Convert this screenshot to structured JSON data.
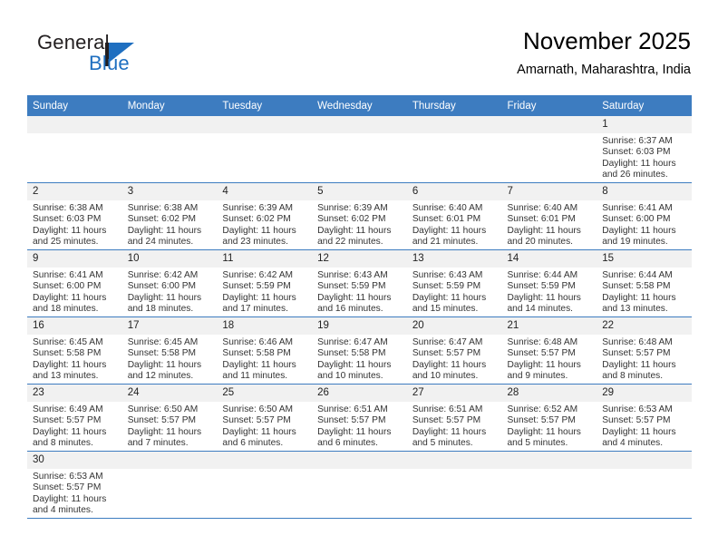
{
  "brand": {
    "name_part1": "General",
    "name_part2": "Blue",
    "logo_icon": "triangle-flag-logo"
  },
  "header": {
    "title": "November 2025",
    "subtitle": "Amarnath, Maharashtra, India"
  },
  "colors": {
    "header_blue": "#3d7cc0",
    "daynum_band": "#f1f1f1",
    "brand_blue": "#1f6fc0",
    "text": "#333333"
  },
  "weekdays": [
    "Sunday",
    "Monday",
    "Tuesday",
    "Wednesday",
    "Thursday",
    "Friday",
    "Saturday"
  ],
  "labels": {
    "sunrise_prefix": "Sunrise:",
    "sunset_prefix": "Sunset:",
    "daylight_prefix": "Daylight:"
  },
  "weeks": [
    [
      {
        "day": "",
        "empty": true
      },
      {
        "day": "",
        "empty": true
      },
      {
        "day": "",
        "empty": true
      },
      {
        "day": "",
        "empty": true
      },
      {
        "day": "",
        "empty": true
      },
      {
        "day": "",
        "empty": true
      },
      {
        "day": "1",
        "sunrise": "Sunrise: 6:37 AM",
        "sunset": "Sunset: 6:03 PM",
        "daylight": "Daylight: 11 hours and 26 minutes."
      }
    ],
    [
      {
        "day": "2",
        "sunrise": "Sunrise: 6:38 AM",
        "sunset": "Sunset: 6:03 PM",
        "daylight": "Daylight: 11 hours and 25 minutes."
      },
      {
        "day": "3",
        "sunrise": "Sunrise: 6:38 AM",
        "sunset": "Sunset: 6:02 PM",
        "daylight": "Daylight: 11 hours and 24 minutes."
      },
      {
        "day": "4",
        "sunrise": "Sunrise: 6:39 AM",
        "sunset": "Sunset: 6:02 PM",
        "daylight": "Daylight: 11 hours and 23 minutes."
      },
      {
        "day": "5",
        "sunrise": "Sunrise: 6:39 AM",
        "sunset": "Sunset: 6:02 PM",
        "daylight": "Daylight: 11 hours and 22 minutes."
      },
      {
        "day": "6",
        "sunrise": "Sunrise: 6:40 AM",
        "sunset": "Sunset: 6:01 PM",
        "daylight": "Daylight: 11 hours and 21 minutes."
      },
      {
        "day": "7",
        "sunrise": "Sunrise: 6:40 AM",
        "sunset": "Sunset: 6:01 PM",
        "daylight": "Daylight: 11 hours and 20 minutes."
      },
      {
        "day": "8",
        "sunrise": "Sunrise: 6:41 AM",
        "sunset": "Sunset: 6:00 PM",
        "daylight": "Daylight: 11 hours and 19 minutes."
      }
    ],
    [
      {
        "day": "9",
        "sunrise": "Sunrise: 6:41 AM",
        "sunset": "Sunset: 6:00 PM",
        "daylight": "Daylight: 11 hours and 18 minutes."
      },
      {
        "day": "10",
        "sunrise": "Sunrise: 6:42 AM",
        "sunset": "Sunset: 6:00 PM",
        "daylight": "Daylight: 11 hours and 18 minutes."
      },
      {
        "day": "11",
        "sunrise": "Sunrise: 6:42 AM",
        "sunset": "Sunset: 5:59 PM",
        "daylight": "Daylight: 11 hours and 17 minutes."
      },
      {
        "day": "12",
        "sunrise": "Sunrise: 6:43 AM",
        "sunset": "Sunset: 5:59 PM",
        "daylight": "Daylight: 11 hours and 16 minutes."
      },
      {
        "day": "13",
        "sunrise": "Sunrise: 6:43 AM",
        "sunset": "Sunset: 5:59 PM",
        "daylight": "Daylight: 11 hours and 15 minutes."
      },
      {
        "day": "14",
        "sunrise": "Sunrise: 6:44 AM",
        "sunset": "Sunset: 5:59 PM",
        "daylight": "Daylight: 11 hours and 14 minutes."
      },
      {
        "day": "15",
        "sunrise": "Sunrise: 6:44 AM",
        "sunset": "Sunset: 5:58 PM",
        "daylight": "Daylight: 11 hours and 13 minutes."
      }
    ],
    [
      {
        "day": "16",
        "sunrise": "Sunrise: 6:45 AM",
        "sunset": "Sunset: 5:58 PM",
        "daylight": "Daylight: 11 hours and 13 minutes."
      },
      {
        "day": "17",
        "sunrise": "Sunrise: 6:45 AM",
        "sunset": "Sunset: 5:58 PM",
        "daylight": "Daylight: 11 hours and 12 minutes."
      },
      {
        "day": "18",
        "sunrise": "Sunrise: 6:46 AM",
        "sunset": "Sunset: 5:58 PM",
        "daylight": "Daylight: 11 hours and 11 minutes."
      },
      {
        "day": "19",
        "sunrise": "Sunrise: 6:47 AM",
        "sunset": "Sunset: 5:58 PM",
        "daylight": "Daylight: 11 hours and 10 minutes."
      },
      {
        "day": "20",
        "sunrise": "Sunrise: 6:47 AM",
        "sunset": "Sunset: 5:57 PM",
        "daylight": "Daylight: 11 hours and 10 minutes."
      },
      {
        "day": "21",
        "sunrise": "Sunrise: 6:48 AM",
        "sunset": "Sunset: 5:57 PM",
        "daylight": "Daylight: 11 hours and 9 minutes."
      },
      {
        "day": "22",
        "sunrise": "Sunrise: 6:48 AM",
        "sunset": "Sunset: 5:57 PM",
        "daylight": "Daylight: 11 hours and 8 minutes."
      }
    ],
    [
      {
        "day": "23",
        "sunrise": "Sunrise: 6:49 AM",
        "sunset": "Sunset: 5:57 PM",
        "daylight": "Daylight: 11 hours and 8 minutes."
      },
      {
        "day": "24",
        "sunrise": "Sunrise: 6:50 AM",
        "sunset": "Sunset: 5:57 PM",
        "daylight": "Daylight: 11 hours and 7 minutes."
      },
      {
        "day": "25",
        "sunrise": "Sunrise: 6:50 AM",
        "sunset": "Sunset: 5:57 PM",
        "daylight": "Daylight: 11 hours and 6 minutes."
      },
      {
        "day": "26",
        "sunrise": "Sunrise: 6:51 AM",
        "sunset": "Sunset: 5:57 PM",
        "daylight": "Daylight: 11 hours and 6 minutes."
      },
      {
        "day": "27",
        "sunrise": "Sunrise: 6:51 AM",
        "sunset": "Sunset: 5:57 PM",
        "daylight": "Daylight: 11 hours and 5 minutes."
      },
      {
        "day": "28",
        "sunrise": "Sunrise: 6:52 AM",
        "sunset": "Sunset: 5:57 PM",
        "daylight": "Daylight: 11 hours and 5 minutes."
      },
      {
        "day": "29",
        "sunrise": "Sunrise: 6:53 AM",
        "sunset": "Sunset: 5:57 PM",
        "daylight": "Daylight: 11 hours and 4 minutes."
      }
    ],
    [
      {
        "day": "30",
        "sunrise": "Sunrise: 6:53 AM",
        "sunset": "Sunset: 5:57 PM",
        "daylight": "Daylight: 11 hours and 4 minutes."
      },
      {
        "day": "",
        "empty": true
      },
      {
        "day": "",
        "empty": true
      },
      {
        "day": "",
        "empty": true
      },
      {
        "day": "",
        "empty": true
      },
      {
        "day": "",
        "empty": true
      },
      {
        "day": "",
        "empty": true
      }
    ]
  ]
}
